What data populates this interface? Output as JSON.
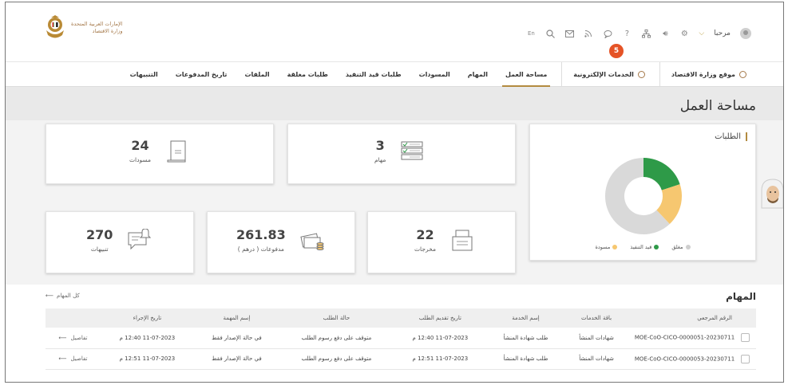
{
  "header": {
    "logo_line1": "الإمارات العربية المتحدة",
    "logo_line2": "وزارة الاقتصاد",
    "greeting": "مرحبا",
    "language_toggle": "En",
    "notification_count": "5"
  },
  "nav": {
    "items": [
      {
        "label": "موقع وزارة الاقتصاد"
      },
      {
        "label": "الخدمات الإلكترونية"
      },
      {
        "label": "مساحة العمل"
      },
      {
        "label": "المهام"
      },
      {
        "label": "المسودات"
      },
      {
        "label": "طلبات قيد التنفيذ"
      },
      {
        "label": "طلبات مغلقة"
      },
      {
        "label": "الملفات"
      },
      {
        "label": "تاريخ المدفوعات"
      },
      {
        "label": "التنبيهات"
      }
    ]
  },
  "page": {
    "title": "مساحة العمل"
  },
  "stats": {
    "drafts": {
      "value": "24",
      "label": "مسودات"
    },
    "tasks": {
      "value": "3",
      "label": "مهام"
    },
    "notifications": {
      "value": "270",
      "label": "تنبيهات"
    },
    "payments": {
      "value": "261.83",
      "label": "مدفوعات ( درهم )"
    },
    "outputs": {
      "value": "22",
      "label": "مخرجات"
    }
  },
  "requests": {
    "title": "الطلبات",
    "legend": [
      {
        "label": "مغلق",
        "color": "#cfcfcf"
      },
      {
        "label": "قيد التنفيذ",
        "color": "#2e9a48"
      },
      {
        "label": "مسودة",
        "color": "#f6c770"
      }
    ]
  },
  "chart_data": {
    "type": "pie",
    "categories": [
      "مغلق",
      "قيد التنفيذ",
      "مسودة"
    ],
    "values": [
      62,
      20,
      18
    ],
    "colors": [
      "#d9d9d9",
      "#2e9a48",
      "#f6c770"
    ]
  },
  "tasks_section": {
    "title": "المهام",
    "all_link": "كل المهام",
    "columns": [
      "الرقم المرجعي",
      "باقة الخدمات",
      "إسم الخدمة",
      "تاريخ تقديم الطلب",
      "حالة الطلب",
      "إسم المهمة",
      "تاريخ الإجراء",
      ""
    ],
    "rows": [
      {
        "ref": "MOE-CoO-CICO-0000051-20230711",
        "package": "شهادات المنشأ",
        "service": "طلب شهادة المنشأ",
        "submitted": "11-07-2023 12:40 م",
        "status": "متوقف على دفع رسوم الطلب",
        "task": "في حالة الإصدار فقط",
        "action_date": "11-07-2023 12:40 م",
        "details": "تفاصيل"
      },
      {
        "ref": "MOE-CoO-CICO-0000053-20230711",
        "package": "شهادات المنشأ",
        "service": "طلب شهادة المنشأ",
        "submitted": "11-07-2023 12:51 م",
        "status": "متوقف على دفع رسوم الطلب",
        "task": "في حالة الإصدار فقط",
        "action_date": "11-07-2023 12:51 م",
        "details": "تفاصيل"
      }
    ]
  }
}
